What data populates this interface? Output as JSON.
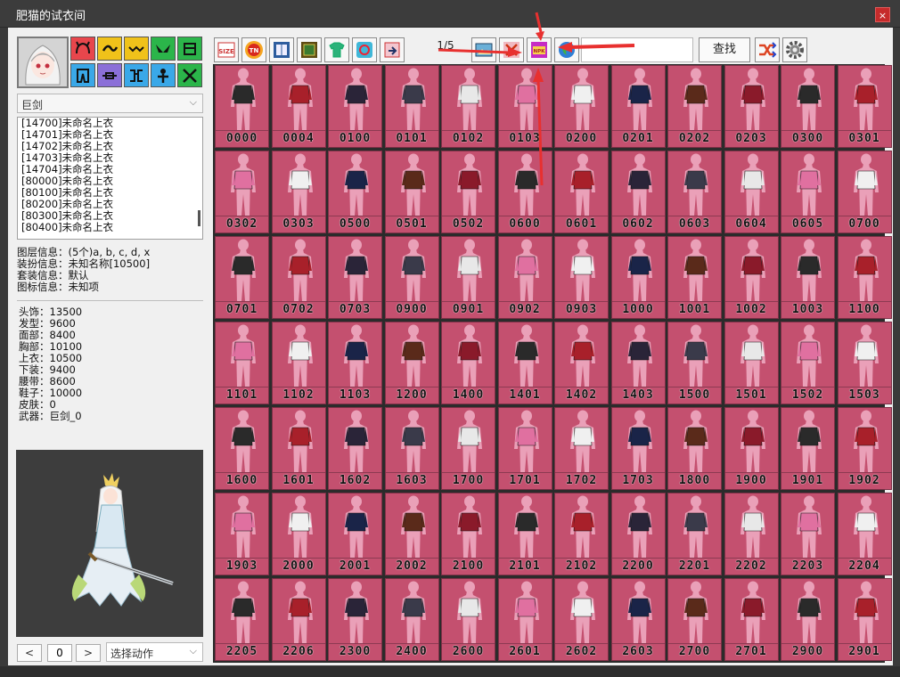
{
  "window": {
    "title": "肥猫的试衣间",
    "close_label": "×"
  },
  "left_panel": {
    "category_select": "巨剑",
    "list_items": [
      "[14700]未命名上衣",
      "[14701]未命名上衣",
      "[14702]未命名上衣",
      "[14703]未命名上衣",
      "[14704]未命名上衣",
      "[80000]未命名上衣",
      "[80100]未命名上衣",
      "[80200]未命名上衣",
      "[80300]未命名上衣",
      "[80400]未命名上衣"
    ],
    "info_lines": [
      "图层信息：(5个)a, b, c, d, x",
      "装扮信息：未知名称[10500]",
      "套装信息：默认",
      "图标信息：未知项"
    ],
    "stats": [
      "头饰：13500",
      "发型：9600",
      "面部：8400",
      "胸部：10100",
      "上衣：10500",
      "下装：9400",
      "腰带：8600",
      "鞋子：10000",
      "皮肤：0",
      "武器：巨剑_0"
    ],
    "prev_label": "<",
    "frame_value": "0",
    "next_label": ">",
    "action_select": "选择动作"
  },
  "slot_colors": [
    "#e8464c",
    "#f0c21a",
    "#f0c21a",
    "#2bb54a",
    "#2bb54a",
    "#3aa8e8",
    "#8b6fd8",
    "#3aa8e8",
    "#3aa8e8",
    "#2bb54a"
  ],
  "toolbar": {
    "page_indicator": "1/5",
    "find_label": "查找",
    "icons": [
      "size-icon",
      "tn-icon",
      "book-icon",
      "frame-icon",
      "shirt-icon",
      "refresh-icon",
      "export-icon",
      "image-icon",
      "close-box-icon",
      "npk-icon",
      "globe-icon"
    ]
  },
  "colors": {
    "cell_bg": "#c4506f",
    "annot_red": "#e8302f"
  },
  "items": [
    "0000",
    "0004",
    "0100",
    "0101",
    "0102",
    "0103",
    "0200",
    "0201",
    "0202",
    "0203",
    "0300",
    "0301",
    "0302",
    "0303",
    "0500",
    "0501",
    "0502",
    "0600",
    "0601",
    "0602",
    "0603",
    "0604",
    "0605",
    "0700",
    "0701",
    "0702",
    "0703",
    "0900",
    "0901",
    "0902",
    "0903",
    "1000",
    "1001",
    "1002",
    "1003",
    "1100",
    "1101",
    "1102",
    "1103",
    "1200",
    "1400",
    "1401",
    "1402",
    "1403",
    "1500",
    "1501",
    "1502",
    "1503",
    "1600",
    "1601",
    "1602",
    "1603",
    "1700",
    "1701",
    "1702",
    "1703",
    "1800",
    "1900",
    "1901",
    "1902",
    "1903",
    "2000",
    "2001",
    "2002",
    "2100",
    "2101",
    "2102",
    "2200",
    "2201",
    "2202",
    "2203",
    "2204",
    "2205",
    "2206",
    "2300",
    "2400",
    "2600",
    "2601",
    "2602",
    "2603",
    "2700",
    "2701",
    "2900",
    "2901"
  ]
}
